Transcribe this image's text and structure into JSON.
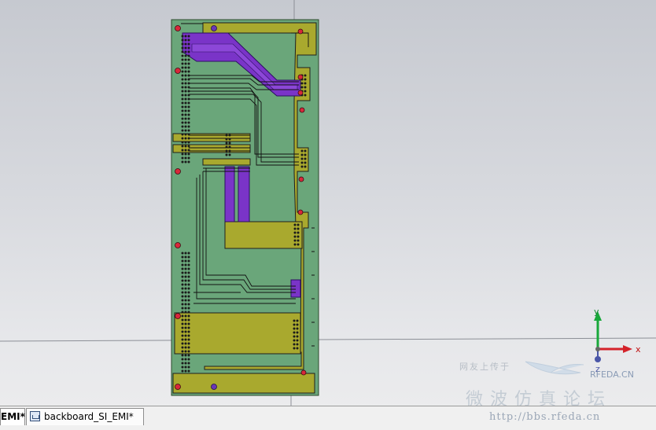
{
  "tabs": [
    {
      "label": "EMI*"
    },
    {
      "label": "backboard_SI_EMI*"
    }
  ],
  "axes": {
    "x": "x",
    "y": "y",
    "z": "z"
  },
  "watermark": {
    "slogan": "网友上传于",
    "brand": "RFEDA.CN",
    "forum": "微波仿真论坛",
    "url": "http://bbs.rfeda.cn"
  },
  "colors": {
    "board": "#6aa67a",
    "copper": "#aaa930",
    "trace": "#7a34c8",
    "pad": "#d8283a",
    "axis_x": "#d4222a",
    "axis_y": "#18a83a",
    "axis_z": "#4a56a8"
  }
}
